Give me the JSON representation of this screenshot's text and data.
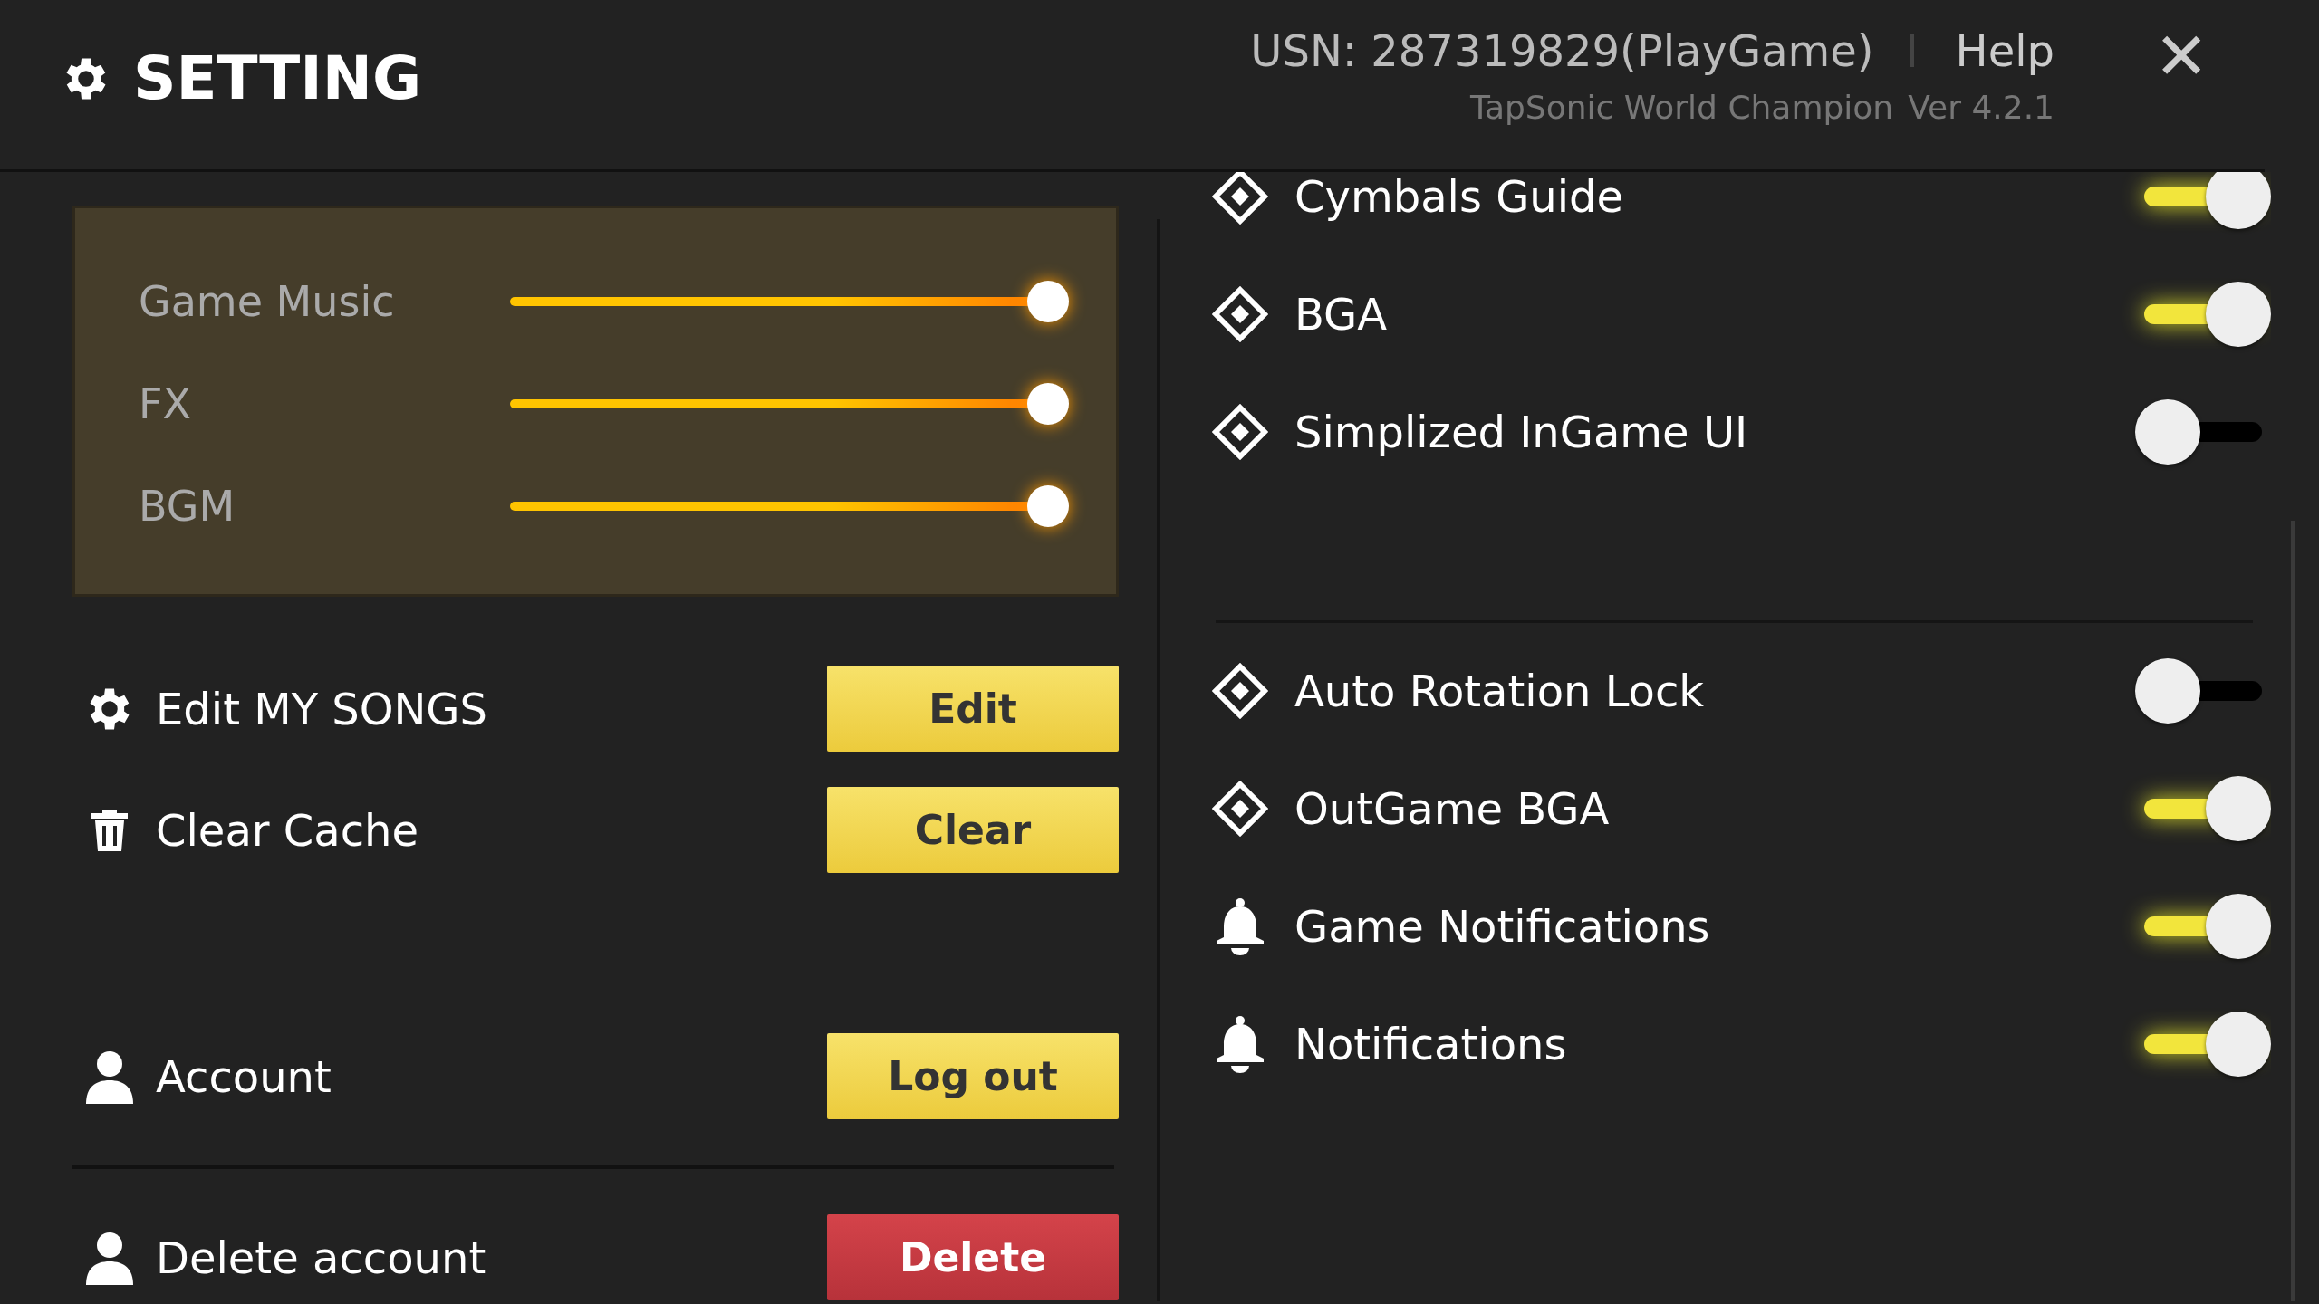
{
  "header": {
    "title": "SETTING",
    "usn": "USN: 287319829(PlayGame)",
    "help": "Help",
    "close": "✕",
    "app_name": "TapSonic World Champion",
    "version": "Ver 4.2.1"
  },
  "volume": [
    {
      "label": "Game Music",
      "level": 1.0
    },
    {
      "label": "FX",
      "level": 1.0
    },
    {
      "label": "BGM",
      "level": 1.0
    }
  ],
  "actions": [
    {
      "kind": "gear",
      "label": "Edit MY SONGS",
      "button": "Edit"
    },
    {
      "kind": "trash",
      "label": "Clear Cache",
      "button": "Clear"
    },
    {
      "kind": "account",
      "label": "Account",
      "button": "Log out"
    },
    {
      "kind": "delete",
      "label": "Delete account",
      "button": "Delete"
    }
  ],
  "toggles": [
    {
      "kind": "diamond",
      "label": "Cymbals Guide",
      "on": true
    },
    {
      "kind": "diamond",
      "label": "BGA",
      "on": true
    },
    {
      "kind": "diamond",
      "label": "Simplized InGame UI",
      "on": false
    }
  ],
  "toggles_2": [
    {
      "kind": "diamond",
      "label": "Auto Rotation Lock",
      "on": false
    },
    {
      "kind": "diamond",
      "label": "OutGame BGA",
      "on": true
    },
    {
      "kind": "bell",
      "label": "Game Notifications",
      "on": true
    },
    {
      "kind": "bell",
      "label": "Notifications",
      "on": true
    }
  ]
}
